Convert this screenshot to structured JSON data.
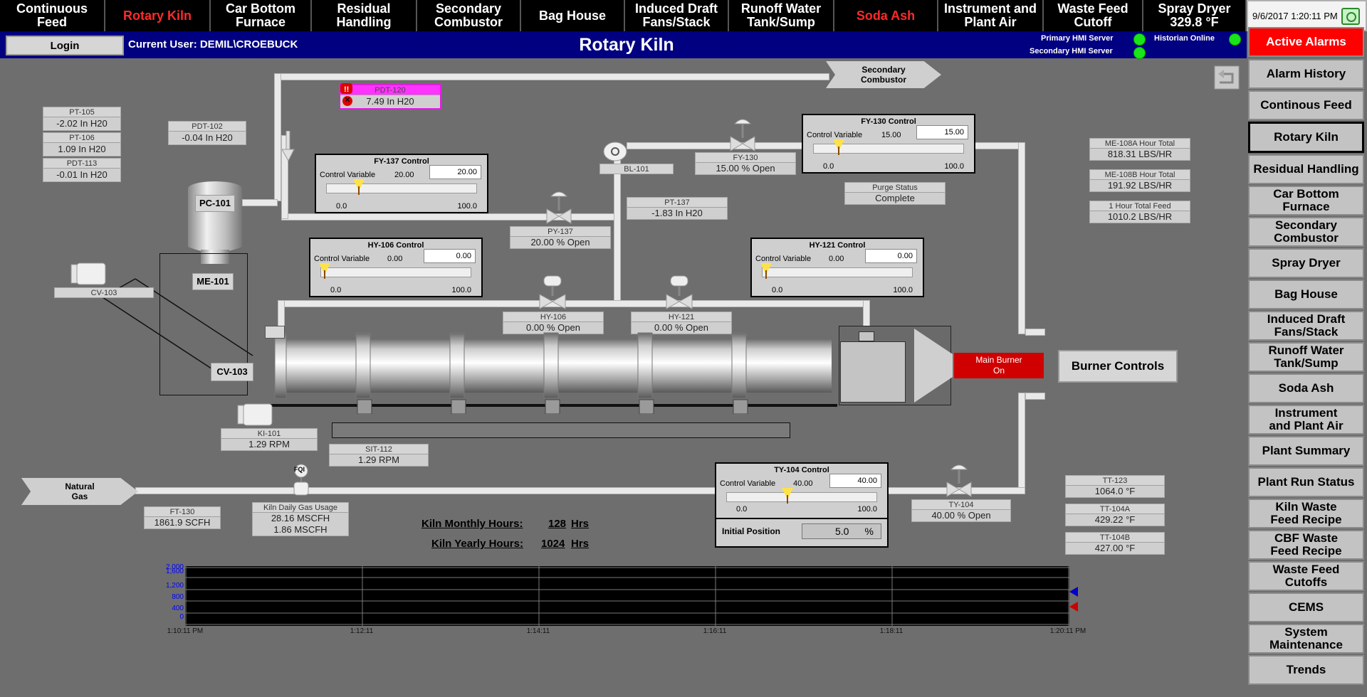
{
  "nav": {
    "tabs": [
      {
        "label": "Continuous Feed"
      },
      {
        "label": "Rotary Kiln",
        "active": true
      },
      {
        "label": "Car Bottom\nFurnace"
      },
      {
        "label": "Residual Handling"
      },
      {
        "label": "Secondary\nCombustor"
      },
      {
        "label": "Bag House"
      },
      {
        "label": "Induced Draft\nFans/Stack"
      },
      {
        "label": "Runoff Water\nTank/Sump"
      },
      {
        "label": "Soda Ash"
      },
      {
        "label": "Instrument and\nPlant Air"
      },
      {
        "label": "Waste Feed\nCutoff"
      },
      {
        "label": "Spray Dryer\n329.8 °F"
      }
    ],
    "clock": "9/6/2017 1:20:11 PM"
  },
  "header": {
    "login": "Login",
    "current_user": "Current User: DEMIL\\CROEBUCK",
    "title": "Rotary Kiln",
    "primary_hmi": "Primary HMI Server",
    "secondary_hmi": "Secondary HMI Server",
    "historian": "Historian Online"
  },
  "side": [
    "Active Alarms",
    "Alarm History",
    "Continous Feed",
    "Rotary Kiln",
    "Residual Handling",
    "Car Bottom\nFurnace",
    "Secondary\nCombustor",
    "Spray Dryer",
    "Bag House",
    "Induced Draft\nFans/Stack",
    "Runoff Water\nTank/Sump",
    "Soda Ash",
    "Instrument\nand Plant Air",
    "Plant Summary",
    "Plant Run Status",
    "Kiln Waste\nFeed Recipe",
    "CBF Waste\nFeed Recipe",
    "Waste Feed\nCutoffs",
    "CEMS",
    "System\nMaintenance",
    "Trends"
  ],
  "tags": {
    "pt105": {
      "name": "PT-105",
      "value": "-2.02 In H20"
    },
    "pt106": {
      "name": "PT-106",
      "value": "1.09 In H20"
    },
    "pdt113": {
      "name": "PDT-113",
      "value": "-0.01 In H20"
    },
    "pdt102": {
      "name": "PDT-102",
      "value": "-0.04 In H20"
    },
    "pdt120": {
      "name": "PDT-120",
      "value": "7.49 In H20"
    },
    "bl101": {
      "name": "BL-101"
    },
    "fy130": {
      "name": "FY-130",
      "value": "15.00 % Open"
    },
    "py137": {
      "name": "PY-137",
      "value": "20.00 % Open"
    },
    "pt137": {
      "name": "PT-137",
      "value": "-1.83 In H20"
    },
    "purge": {
      "name": "Purge Status",
      "value": "Complete"
    },
    "me108a": {
      "name": "ME-108A Hour Total",
      "value": "818.31 LBS/HR"
    },
    "me108b": {
      "name": "ME-108B Hour Total",
      "value": "191.92 LBS/HR"
    },
    "hourtotal": {
      "name": "1 Hour Total Feed",
      "value": "1010.2 LBS/HR"
    },
    "cv103": {
      "name": "CV-103"
    },
    "hy106": {
      "name": "HY-106",
      "value": "0.00 % Open"
    },
    "hy121": {
      "name": "HY-121",
      "value": "0.00 % Open"
    },
    "ki101": {
      "name": "KI-101",
      "value": "1.29 RPM"
    },
    "sit112": {
      "name": "SIT-112",
      "value": "1.29 RPM"
    },
    "ft130": {
      "name": "FT-130",
      "value": "1861.9 SCFH"
    },
    "kilngas": {
      "name": "Kiln Daily Gas Usage",
      "value1": "28.16 MSCFH",
      "value2": "1.86 MSCFH"
    },
    "ty104": {
      "name": "TY-104",
      "value": "40.00 % Open"
    },
    "tt123": {
      "name": "TT-123",
      "value": "1064.0 °F"
    },
    "tt104a": {
      "name": "TT-104A",
      "value": "429.22 °F"
    },
    "tt104b": {
      "name": "TT-104B",
      "value": "427.00 °F"
    }
  },
  "controls": {
    "fy137": {
      "title": "FY-137 Control",
      "label": "Control Variable",
      "cv": "20.00",
      "input": "20.00",
      "min": "0.0",
      "max": "100.0",
      "level": 0.2
    },
    "fy130": {
      "title": "FY-130 Control",
      "label": "Control Variable",
      "cv": "15.00",
      "input": "15.00",
      "min": "0.0",
      "max": "100.0",
      "level": 0.15
    },
    "hy106": {
      "title": "HY-106 Control",
      "label": "Control Variable",
      "cv": "0.00",
      "input": "0.00",
      "min": "0.0",
      "max": "100.0",
      "level": 0.0
    },
    "hy121": {
      "title": "HY-121 Control",
      "label": "Control Variable",
      "cv": "0.00",
      "input": "0.00",
      "min": "0.0",
      "max": "100.0",
      "level": 0.0
    },
    "ty104": {
      "title": "TY-104 Control",
      "label": "Control Variable",
      "cv": "40.00",
      "input": "40.00",
      "min": "0.0",
      "max": "100.0",
      "level": 0.4,
      "init_label": "Initial Position",
      "init_value": "5.0",
      "init_unit": "%"
    }
  },
  "labels": {
    "pc101": "PC-101",
    "me101": "ME-101",
    "cv103": "CV-103",
    "secondary_combustor": "Secondary\nCombustor",
    "natural_gas": "Natural\nGas",
    "main_burner": "Main Burner\nOn",
    "burner_controls": "Burner Controls",
    "fqi": "FQI"
  },
  "hours": {
    "monthly_label": "Kiln Monthly Hours:",
    "monthly_value": "128",
    "monthly_unit": "Hrs",
    "yearly_label": "Kiln Yearly Hours:",
    "yearly_value": "1024",
    "yearly_unit": "Hrs"
  },
  "chart_data": {
    "type": "line",
    "y_ticks": [
      "2,000",
      "1,600",
      "1,200",
      "800",
      "400",
      "0"
    ],
    "x_ticks": [
      "1:10:11 PM",
      "1:12:11",
      "1:14:11",
      "1:16:11",
      "1:18:11",
      "1:20:11 PM"
    ],
    "ylim": [
      0,
      2000
    ],
    "markers": [
      "blue",
      "red"
    ]
  }
}
